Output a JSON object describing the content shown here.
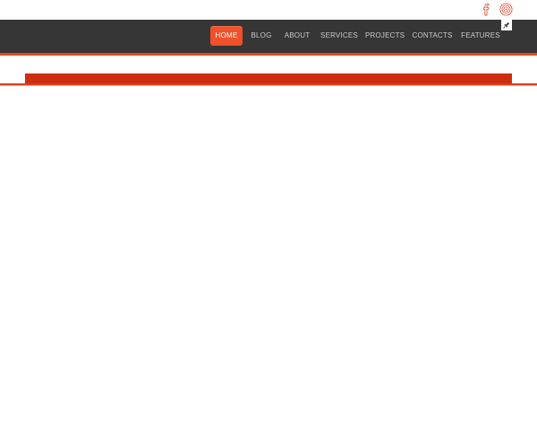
{
  "social": {
    "facebook_icon": "facebook-icon",
    "dribbble_icon": "dribbble-icon",
    "icon_color": "#e4583b"
  },
  "nav": {
    "items": [
      {
        "label": "HOME",
        "active": true
      },
      {
        "label": "BLOG",
        "active": false
      },
      {
        "label": "ABOUT",
        "active": false
      },
      {
        "label": "SERVICES",
        "active": false
      },
      {
        "label": "PROJECTS",
        "active": false
      },
      {
        "label": "CONTACTS",
        "active": false
      },
      {
        "label": "FEATURES",
        "active": false
      }
    ],
    "bar_color": "#363636",
    "active_color": "#f0502a",
    "accent_color": "#e04a1f"
  },
  "pin_icon": "pin-icon",
  "band_color": "#cc2e10"
}
